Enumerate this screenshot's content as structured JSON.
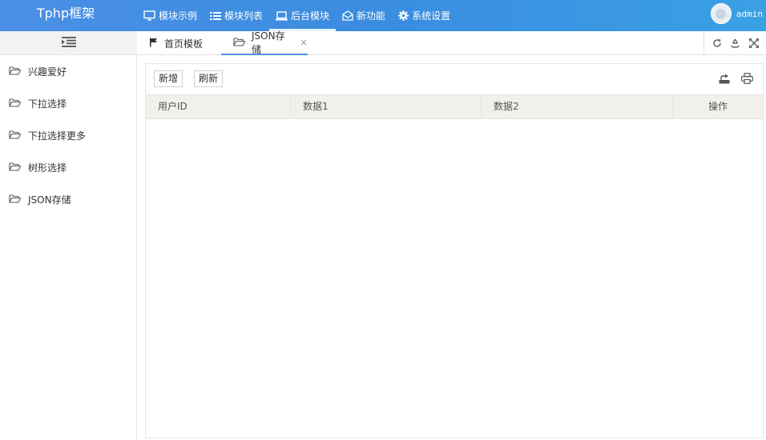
{
  "app": {
    "title": "Tphp框架"
  },
  "topnav": [
    {
      "label": "模块示例",
      "icon": "monitor-icon"
    },
    {
      "label": "模块列表",
      "icon": "list-icon"
    },
    {
      "label": "后台模块",
      "icon": "laptop-icon",
      "active": true
    },
    {
      "label": "新功能",
      "icon": "envelope-open-icon"
    },
    {
      "label": "系统设置",
      "icon": "gear-icon"
    }
  ],
  "user": {
    "name": "admin"
  },
  "sidebar": {
    "items": [
      {
        "label": "兴趣爱好"
      },
      {
        "label": "下拉选择"
      },
      {
        "label": "下拉选择更多"
      },
      {
        "label": "树形选择"
      },
      {
        "label": "JSON存储"
      }
    ]
  },
  "tabs": {
    "home": {
      "label": "首页模板"
    },
    "active": {
      "label": "JSON存储",
      "close": "×"
    }
  },
  "toolbar": {
    "add_label": "新增",
    "refresh_label": "刷新"
  },
  "table": {
    "columns": [
      "用户ID",
      "数据1",
      "数据2",
      "操作"
    ],
    "rows": []
  },
  "colors": {
    "topbar": "#3a8de0",
    "accent": "#4a8fe6",
    "thead": "#f2f0ec"
  }
}
